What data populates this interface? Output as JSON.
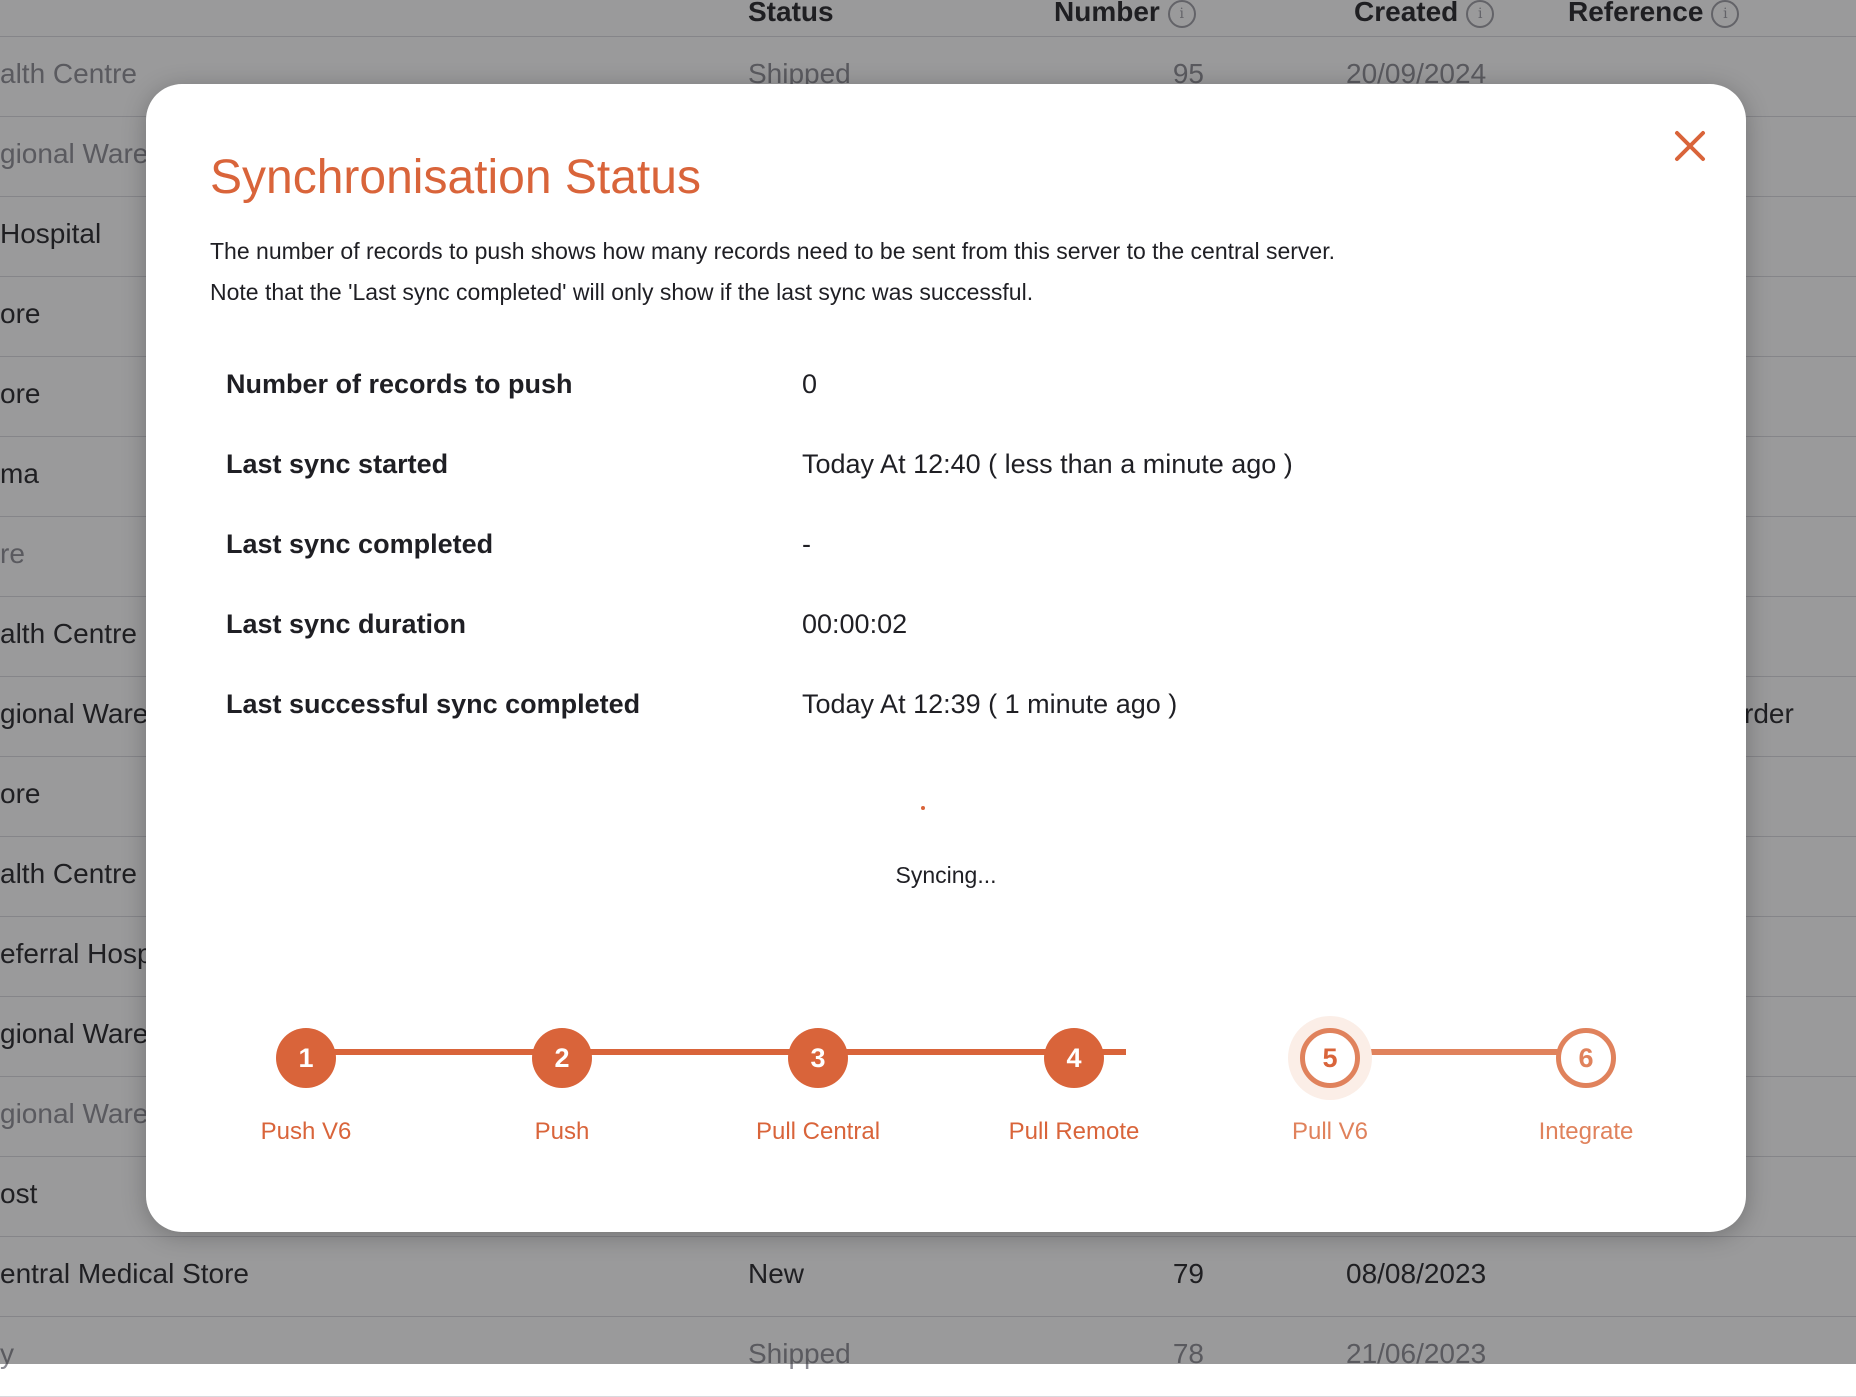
{
  "background": {
    "headers": {
      "status": "Status",
      "number": "Number",
      "created": "Created",
      "reference": "Reference"
    },
    "rows": [
      {
        "name": "alth Centre",
        "status": "Shipped",
        "number": "95",
        "created": "20/09/2024",
        "reference": "",
        "dim": true
      },
      {
        "name": "gional Ware",
        "status": "",
        "number": "",
        "created": "",
        "reference": "",
        "dim": true
      },
      {
        "name": "Hospital",
        "status": "",
        "number": "",
        "created": "",
        "reference": "",
        "dim": false
      },
      {
        "name": "ore",
        "status": "",
        "number": "",
        "created": "",
        "reference": "",
        "dim": false
      },
      {
        "name": "ore",
        "status": "",
        "number": "",
        "created": "",
        "reference": "",
        "dim": false
      },
      {
        "name": "ma",
        "status": "",
        "number": "",
        "created": "",
        "reference": "",
        "dim": false
      },
      {
        "name": "re",
        "status": "",
        "number": "",
        "created": "",
        "reference": "",
        "dim": true
      },
      {
        "name": "alth Centre",
        "status": "",
        "number": "",
        "created": "",
        "reference": "",
        "dim": false
      },
      {
        "name": "gional Ware",
        "status": "",
        "number": "",
        "created": "",
        "reference": "rder",
        "dim": false
      },
      {
        "name": "ore",
        "status": "",
        "number": "",
        "created": "",
        "reference": "",
        "dim": false
      },
      {
        "name": "alth Centre",
        "status": "",
        "number": "",
        "created": "",
        "reference": "",
        "dim": false
      },
      {
        "name": "eferral Hosp",
        "status": "",
        "number": "",
        "created": "",
        "reference": "",
        "dim": false
      },
      {
        "name": "gional Ware",
        "status": "",
        "number": "",
        "created": "",
        "reference": "",
        "dim": false
      },
      {
        "name": "gional Ware",
        "status": "",
        "number": "",
        "created": "",
        "reference": "",
        "dim": true
      },
      {
        "name": "ost",
        "status": "",
        "number": "",
        "created": "",
        "reference": "",
        "dim": false
      },
      {
        "name": "entral Medical Store",
        "status": "New",
        "number": "79",
        "created": "08/08/2023",
        "reference": "",
        "dim": false
      },
      {
        "name": "y",
        "status": "Shipped",
        "number": "78",
        "created": "21/06/2023",
        "reference": "",
        "dim": true
      }
    ]
  },
  "modal": {
    "title": "Synchronisation Status",
    "description_1": "The number of records to push shows how many records need to be sent from this server to the central server.",
    "description_2": "Note that the 'Last sync completed' will only show if the last sync was successful.",
    "rows": [
      {
        "label": "Number of records to push",
        "value": "0"
      },
      {
        "label": "Last sync started",
        "value": "Today At 12:40  ( less than a minute ago )"
      },
      {
        "label": "Last sync completed",
        "value": "-"
      },
      {
        "label": "Last sync duration",
        "value": "00:00:02"
      },
      {
        "label": "Last successful sync completed",
        "value": "Today At 12:39  ( 1 minute ago )"
      }
    ],
    "syncing_text": "Syncing...",
    "steps": [
      {
        "number": "1",
        "label": "Push V6",
        "state": "done"
      },
      {
        "number": "2",
        "label": "Push",
        "state": "done"
      },
      {
        "number": "3",
        "label": "Pull Central",
        "state": "done"
      },
      {
        "number": "4",
        "label": "Pull Remote",
        "state": "done"
      },
      {
        "number": "5",
        "label": "Pull V6",
        "state": "active"
      },
      {
        "number": "6",
        "label": "Integrate",
        "state": "pending"
      }
    ]
  },
  "colors": {
    "accent": "#d9643a",
    "accent_light": "#e0825c",
    "overlay": "rgba(30,30,34,0.45)"
  },
  "icons": {
    "close": "close-icon",
    "info": "info-icon"
  }
}
